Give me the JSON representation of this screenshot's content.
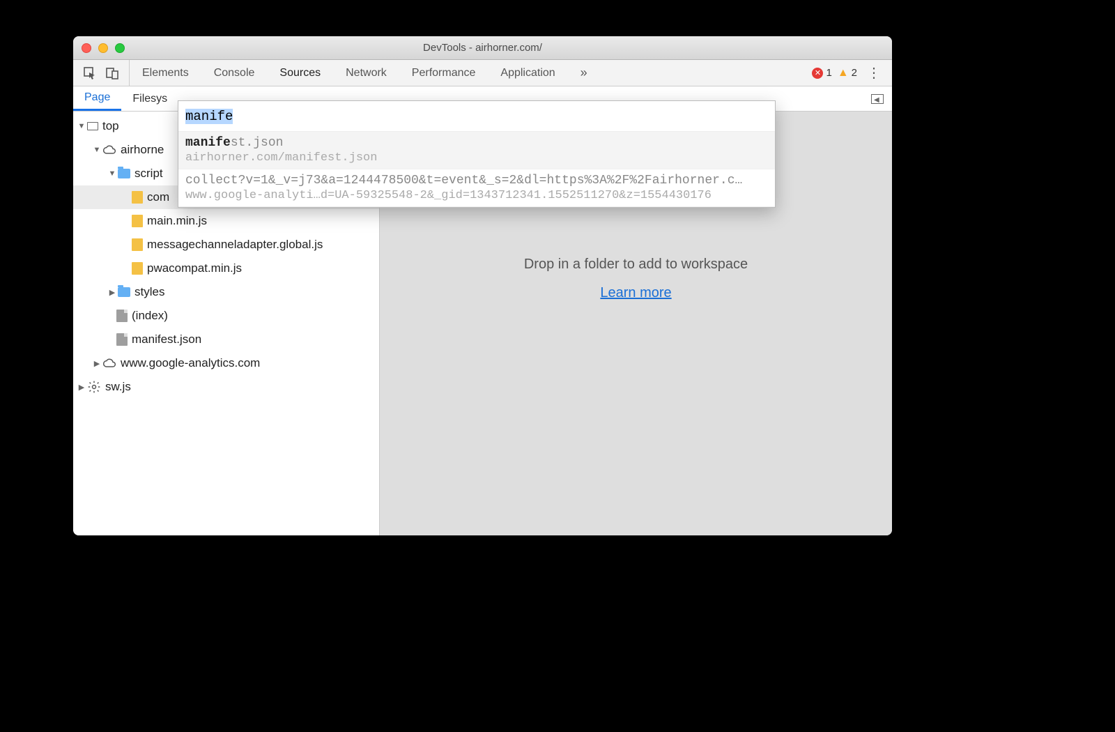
{
  "window": {
    "title": "DevTools - airhorner.com/"
  },
  "toolbar": {
    "tabs": [
      "Elements",
      "Console",
      "Sources",
      "Network",
      "Performance",
      "Application"
    ],
    "active_tab": "Sources",
    "overflow_glyph": "»",
    "errors": "1",
    "warnings": "2"
  },
  "subtabs": {
    "items": [
      "Page",
      "Filesys"
    ],
    "active": "Page"
  },
  "tree": {
    "top": "top",
    "domain": "airhorne",
    "scripts_folder": "script",
    "files": {
      "comlink": "com",
      "main": "main.min.js",
      "mca": "messagechanneladapter.global.js",
      "pwa": "pwacompat.min.js"
    },
    "styles": "styles",
    "index": "(index)",
    "manifest": "manifest.json",
    "ga": "www.google-analytics.com",
    "sw": "sw.js"
  },
  "main": {
    "drop_text": "Drop in a folder to add to workspace",
    "learn": "Learn more"
  },
  "quickopen": {
    "query": "manife",
    "results": [
      {
        "title_match": "manife",
        "title_rest": "st.json",
        "subtitle": "airhorner.com/manifest.json"
      },
      {
        "title_match": "",
        "title_rest": "collect?v=1&_v=j73&a=1244478500&t=event&_s=2&dl=https%3A%2F%2Fairhorner.c…",
        "subtitle": "www.google-analyti…d=UA-59325548-2&_gid=1343712341.1552511270&z=1554430176"
      }
    ]
  }
}
